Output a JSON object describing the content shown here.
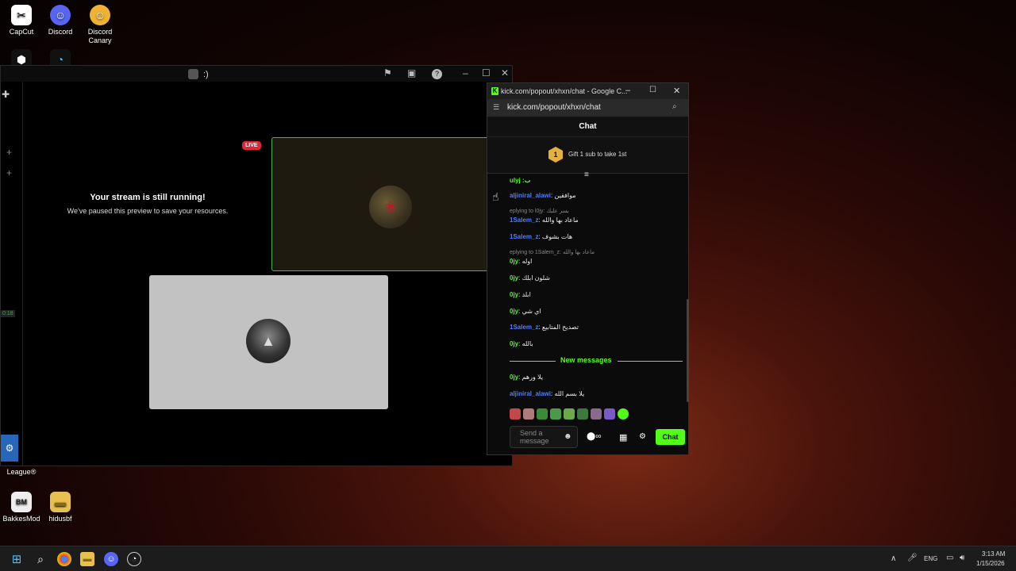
{
  "desktop": {
    "icons": [
      {
        "label": "CapCut"
      },
      {
        "label": "Discord"
      },
      {
        "label": "Discord Canary"
      },
      {
        "label": "Rocket League®"
      },
      {
        "label": "BakkesMod"
      },
      {
        "label": "hidusbf"
      }
    ]
  },
  "game_window": {
    "title": ":)",
    "live_badge": "LIVE",
    "paused_title": "Your stream is still running!",
    "paused_subtitle": "We've paused this preview to save your resources.",
    "side_time": "0:18"
  },
  "chat_window": {
    "title": "kick.com/popout/xhxn/chat - Google C...",
    "url": "kick.com/popout/xhxn/chat",
    "header": "Chat",
    "gift_badge": "1",
    "gift_text": "Gift 1 sub to take 1st",
    "partial_top": "ulyj :ب",
    "messages": [
      {
        "user": "aljiniral_alawi",
        "text": "موافقين",
        "user_color": "#4f7dff"
      },
      {
        "reply": "eplying to l0jy: بسر عليك"
      },
      {
        "user": "1Salem_z",
        "text": "ماعاد بها والله",
        "user_color": "#4f7dff"
      },
      {
        "user": "1Salem_z",
        "text": "هات بشوف",
        "user_color": "#4f7dff"
      },
      {
        "reply": "eplying to 1Salem_z: ماعاد بها والله"
      },
      {
        "user": "0jy",
        "text": "اوله",
        "user_color": "#53fc18"
      },
      {
        "user": "0jy",
        "text": "شلون ابلك",
        "user_color": "#53fc18"
      },
      {
        "user": "0jy",
        "text": "ابلد",
        "user_color": "#53fc18"
      },
      {
        "user": "0jy",
        "text": "اي شي",
        "user_color": "#53fc18"
      },
      {
        "user": "1Salem_z",
        "text": "تصديح المتابيع",
        "user_color": "#4f7dff"
      },
      {
        "user": "0jy",
        "text": "بالله",
        "user_color": "#53fc18"
      }
    ],
    "new_messages_label": "New messages",
    "new_messages": [
      {
        "user": "0jy",
        "text": "يلا ورهم",
        "user_color": "#53fc18"
      },
      {
        "user": "aljiniral_alawi",
        "text": "يلا بسم الله",
        "user_color": "#4f7dff"
      }
    ],
    "input_placeholder": "Send a message",
    "chat_button": "Chat"
  },
  "taskbar": {
    "language": "ENG",
    "time": "3:13 AM",
    "date": "1/15/2026"
  }
}
